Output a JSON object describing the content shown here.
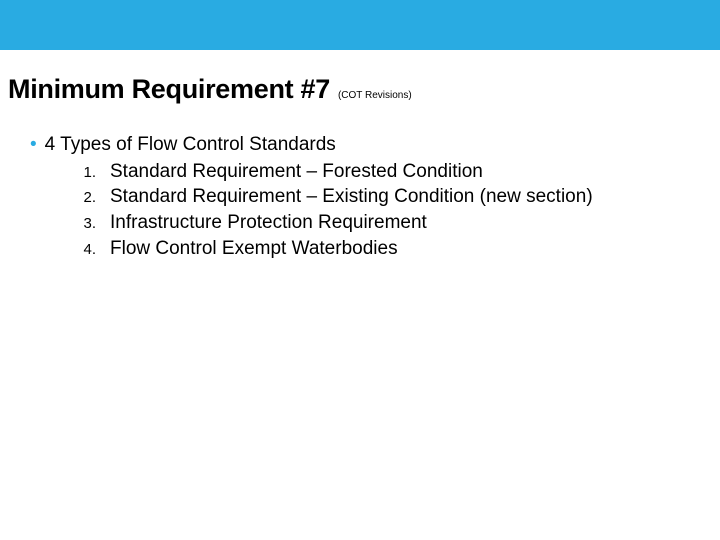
{
  "banner": {
    "color": "#29abe2"
  },
  "heading": {
    "title": "Minimum Requirement #7",
    "subtitle": "(COT Revisions)"
  },
  "body": {
    "lead_bullet": "4 Types of Flow Control Standards",
    "items": [
      {
        "num": "1.",
        "text": "Standard Requirement – Forested Condition"
      },
      {
        "num": "2.",
        "text": "Standard Requirement – Existing Condition (new section)"
      },
      {
        "num": "3.",
        "text": "Infrastructure Protection Requirement"
      },
      {
        "num": "4.",
        "text": "Flow Control Exempt Waterbodies"
      }
    ]
  }
}
